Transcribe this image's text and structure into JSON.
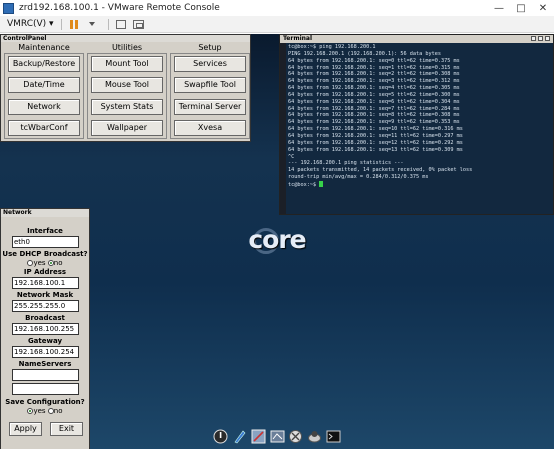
{
  "window": {
    "title": "zrd192.168.100.1 - VMware Remote Console",
    "controls": [
      "—",
      "□",
      "✕"
    ]
  },
  "toolbar": {
    "menu_label": "VMRC(V) ▾"
  },
  "control_panel": {
    "title": "ControlPanel",
    "columns": [
      {
        "header": "Maintenance",
        "buttons": [
          "Backup/Restore",
          "Date/Time",
          "Network",
          "tcWbarConf"
        ]
      },
      {
        "header": "Utilities",
        "buttons": [
          "Mount Tool",
          "Mouse Tool",
          "System Stats",
          "Wallpaper"
        ]
      },
      {
        "header": "Setup",
        "buttons": [
          "Services",
          "Swapfile Tool",
          "Terminal Server",
          "Xvesa"
        ]
      }
    ]
  },
  "terminal": {
    "title": "Terminal",
    "lines": [
      "tc@box:~$ ping 192.168.200.1",
      "PING 192.168.200.1 (192.168.200.1): 56 data bytes",
      "64 bytes from 192.168.200.1: seq=0 ttl=62 time=0.375 ms",
      "64 bytes from 192.168.200.1: seq=1 ttl=62 time=0.315 ms",
      "64 bytes from 192.168.200.1: seq=2 ttl=62 time=0.308 ms",
      "64 bytes from 192.168.200.1: seq=3 ttl=62 time=0.312 ms",
      "64 bytes from 192.168.200.1: seq=4 ttl=62 time=0.305 ms",
      "64 bytes from 192.168.200.1: seq=5 ttl=62 time=0.300 ms",
      "64 bytes from 192.168.200.1: seq=6 ttl=62 time=0.304 ms",
      "64 bytes from 192.168.200.1: seq=7 ttl=62 time=0.284 ms",
      "64 bytes from 192.168.200.1: seq=8 ttl=62 time=0.308 ms",
      "64 bytes from 192.168.200.1: seq=9 ttl=62 time=0.353 ms",
      "64 bytes from 192.168.200.1: seq=10 ttl=62 time=0.316 ms",
      "64 bytes from 192.168.200.1: seq=11 ttl=62 time=0.297 ms",
      "64 bytes from 192.168.200.1: seq=12 ttl=62 time=0.292 ms",
      "64 bytes from 192.168.200.1: seq=13 ttl=62 time=0.309 ms",
      "^C",
      "--- 192.168.200.1 ping statistics ---",
      "14 packets transmitted, 14 packets received, 0% packet loss",
      "round-trip min/avg/max = 0.284/0.312/0.375 ms"
    ],
    "prompt": "tc@box:~$ "
  },
  "logo": {
    "text": "core"
  },
  "network": {
    "title": "Network",
    "interface_label": "Interface",
    "interface_value": "eth0",
    "dhcp_label": "Use DHCP Broadcast?",
    "dhcp_yes": "yes",
    "dhcp_no": "no",
    "dhcp_selected": "no",
    "ip_label": "IP Address",
    "ip_value": "192.168.100.1",
    "mask_label": "Network Mask",
    "mask_value": "255.255.255.0",
    "broadcast_label": "Broadcast",
    "broadcast_value": "192.168.100.255",
    "gateway_label": "Gateway",
    "gateway_value": "192.168.100.254",
    "nameservers_label": "NameServers",
    "nameserver1": "",
    "nameserver2": "",
    "save_label": "Save Configuration?",
    "save_yes": "yes",
    "save_no": "no",
    "save_selected": "yes",
    "apply_label": "Apply",
    "exit_label": "Exit"
  },
  "dock": {
    "icons": [
      "power-icon",
      "editor-icon",
      "control-panel-icon",
      "apps-icon",
      "network-tool-icon",
      "mount-icon",
      "terminal-icon"
    ]
  },
  "colors": {
    "panel_bg": "#d4d0c8",
    "terminal_bg": "#12283f",
    "cursor": "#37d24a",
    "pause_icon": "#e08a1b"
  }
}
